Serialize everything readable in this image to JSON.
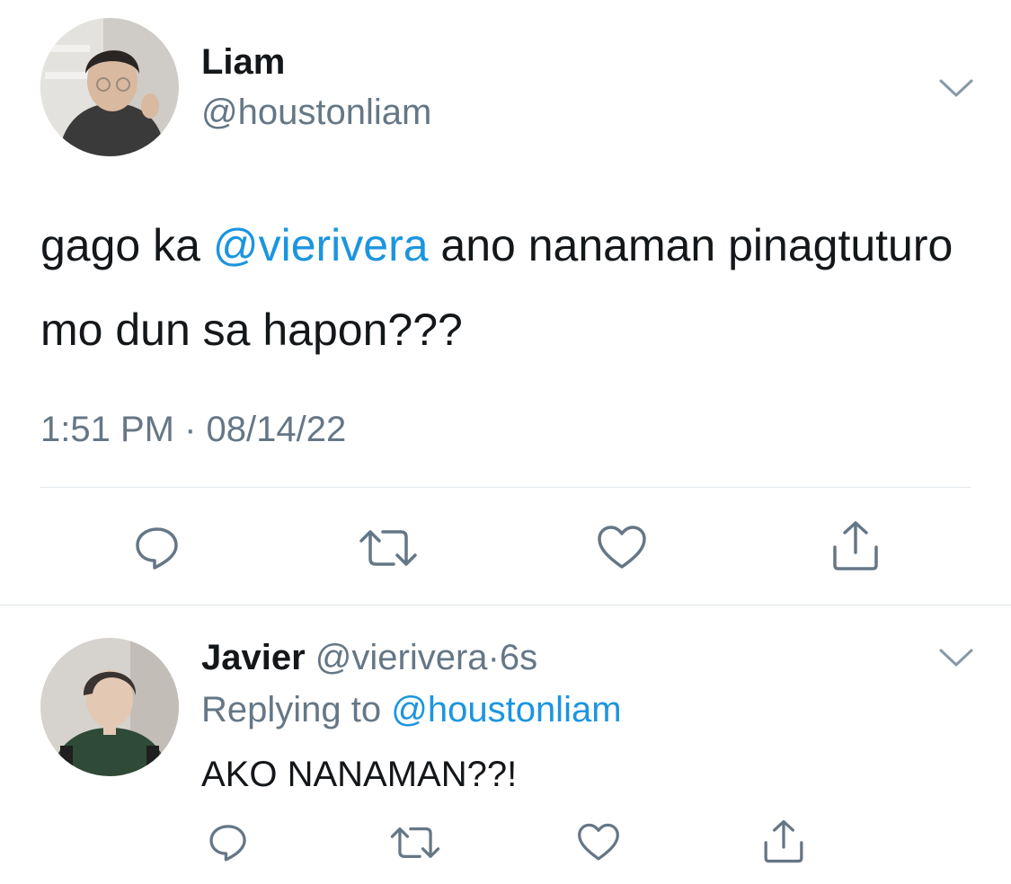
{
  "main_tweet": {
    "author": {
      "name": "Liam",
      "handle": "@houstonliam",
      "avatar_icon": "user-avatar-photo"
    },
    "text_before": "gago ka ",
    "mention": "@vierivera",
    "text_after": " ano nanaman pinagtuturo mo dun sa hapon???",
    "timestamp": "1:51 PM · 08/14/22",
    "actions": [
      "reply-icon",
      "retweet-icon",
      "like-icon",
      "share-icon"
    ],
    "menu_icon": "chevron-down-icon"
  },
  "reply_tweet": {
    "author": {
      "name": "Javier",
      "handle": "@vierivera",
      "separator": "·",
      "time": "6s",
      "avatar_icon": "user-avatar-photo"
    },
    "replying_to_label": "Replying to ",
    "replying_to_handle": "@houstonliam",
    "text": "AKO NANAMAN??!",
    "actions": [
      "reply-icon",
      "retweet-icon",
      "like-icon",
      "share-icon"
    ],
    "menu_icon": "chevron-down-icon"
  },
  "colors": {
    "text_primary": "#14171a",
    "text_secondary": "#657786",
    "link": "#1b95e0",
    "divider": "#e1e8ed",
    "icon": "#657786"
  }
}
